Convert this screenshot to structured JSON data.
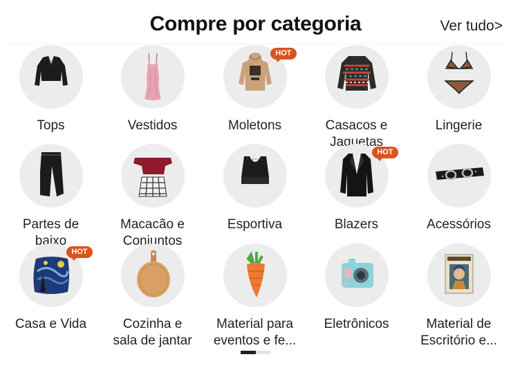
{
  "header": {
    "title": "Compre por categoria",
    "view_all": "Ver tudo>"
  },
  "badge": {
    "hot": "HOT"
  },
  "categories": [
    {
      "label": "Tops",
      "icon": "crop-top-icon",
      "hot": false
    },
    {
      "label": "Vestidos",
      "icon": "slip-dress-icon",
      "hot": false
    },
    {
      "label": "Moletons",
      "icon": "hoodie-icon",
      "hot": true
    },
    {
      "label": "Casacos e\nJaquetas",
      "icon": "patterned-sweater-icon",
      "hot": false
    },
    {
      "label": "Lingerie",
      "icon": "lingerie-icon",
      "hot": false
    },
    {
      "label": "Partes de\nbaixo",
      "icon": "joggers-icon",
      "hot": false
    },
    {
      "label": "Macacão e\nConjuntos",
      "icon": "two-piece-set-icon",
      "hot": false
    },
    {
      "label": "Esportiva",
      "icon": "sports-bra-icon",
      "hot": false
    },
    {
      "label": "Blazers",
      "icon": "blazer-icon",
      "hot": true
    },
    {
      "label": "Acessórios",
      "icon": "belt-icon",
      "hot": false
    },
    {
      "label": "Casa e Vida",
      "icon": "starry-night-pillow-icon",
      "hot": true
    },
    {
      "label": "Cozinha e\nsala de jantar",
      "icon": "cutting-board-icon",
      "hot": false
    },
    {
      "label": "Material para\neventos e fe...",
      "icon": "carrot-pinata-icon",
      "hot": false
    },
    {
      "label": "Eletrônicos",
      "icon": "kids-camera-icon",
      "hot": false
    },
    {
      "label": "Material de\nEscritório e...",
      "icon": "vintage-notebook-icon",
      "hot": false
    }
  ],
  "pager": {
    "pages": 2,
    "current": 1
  }
}
